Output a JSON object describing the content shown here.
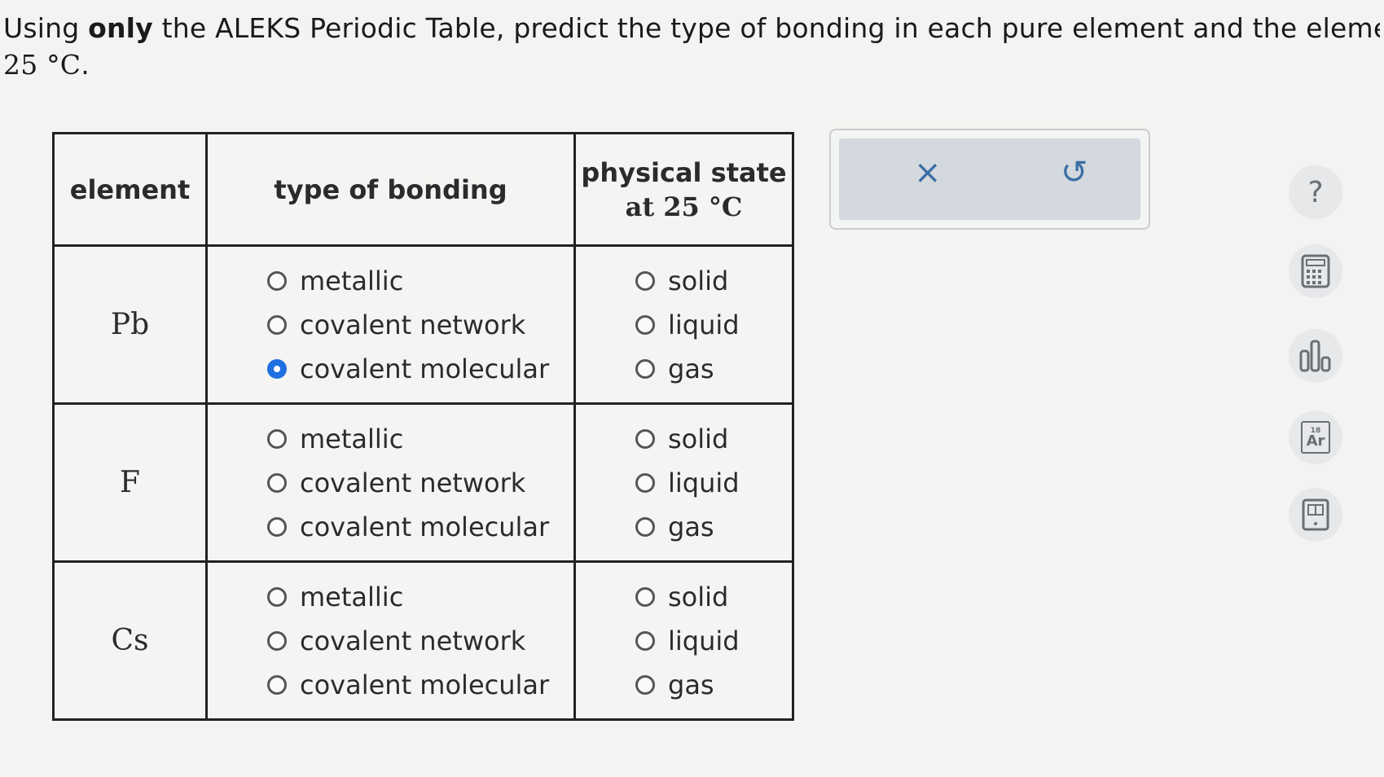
{
  "prompt": {
    "part1": "Using ",
    "bold": "only",
    "part2": " the ALEKS Periodic Table, predict the type of bonding in each pure element and the element's phy",
    "temp": "25 °C",
    "period": "."
  },
  "table": {
    "headers": {
      "element": "element",
      "bonding": "type of bonding",
      "state_line1": "physical state",
      "state_line2": "at 25 °C"
    },
    "rows": [
      {
        "element": "Pb",
        "bonding": [
          "metallic",
          "covalent network",
          "covalent molecular"
        ],
        "bonding_selected": 2,
        "state": [
          "solid",
          "liquid",
          "gas"
        ],
        "state_selected": -1
      },
      {
        "element": "F",
        "bonding": [
          "metallic",
          "covalent network",
          "covalent molecular"
        ],
        "bonding_selected": -1,
        "state": [
          "solid",
          "liquid",
          "gas"
        ],
        "state_selected": -1
      },
      {
        "element": "Cs",
        "bonding": [
          "metallic",
          "covalent network",
          "covalent molecular"
        ],
        "bonding_selected": -1,
        "state": [
          "solid",
          "liquid",
          "gas"
        ],
        "state_selected": -1
      }
    ]
  },
  "actions": {
    "clear_glyph": "×",
    "undo_glyph": "↺",
    "accent": "#3a6ea5"
  },
  "tools": {
    "help_glyph": "?",
    "ptable_label": "Ar",
    "ptable_number": "18",
    "icons": [
      "help-icon",
      "calculator-icon",
      "bar-chart-icon",
      "periodic-table-icon",
      "textbook-icon"
    ]
  },
  "colors": {
    "selected_radio": "#1e6fe0"
  }
}
